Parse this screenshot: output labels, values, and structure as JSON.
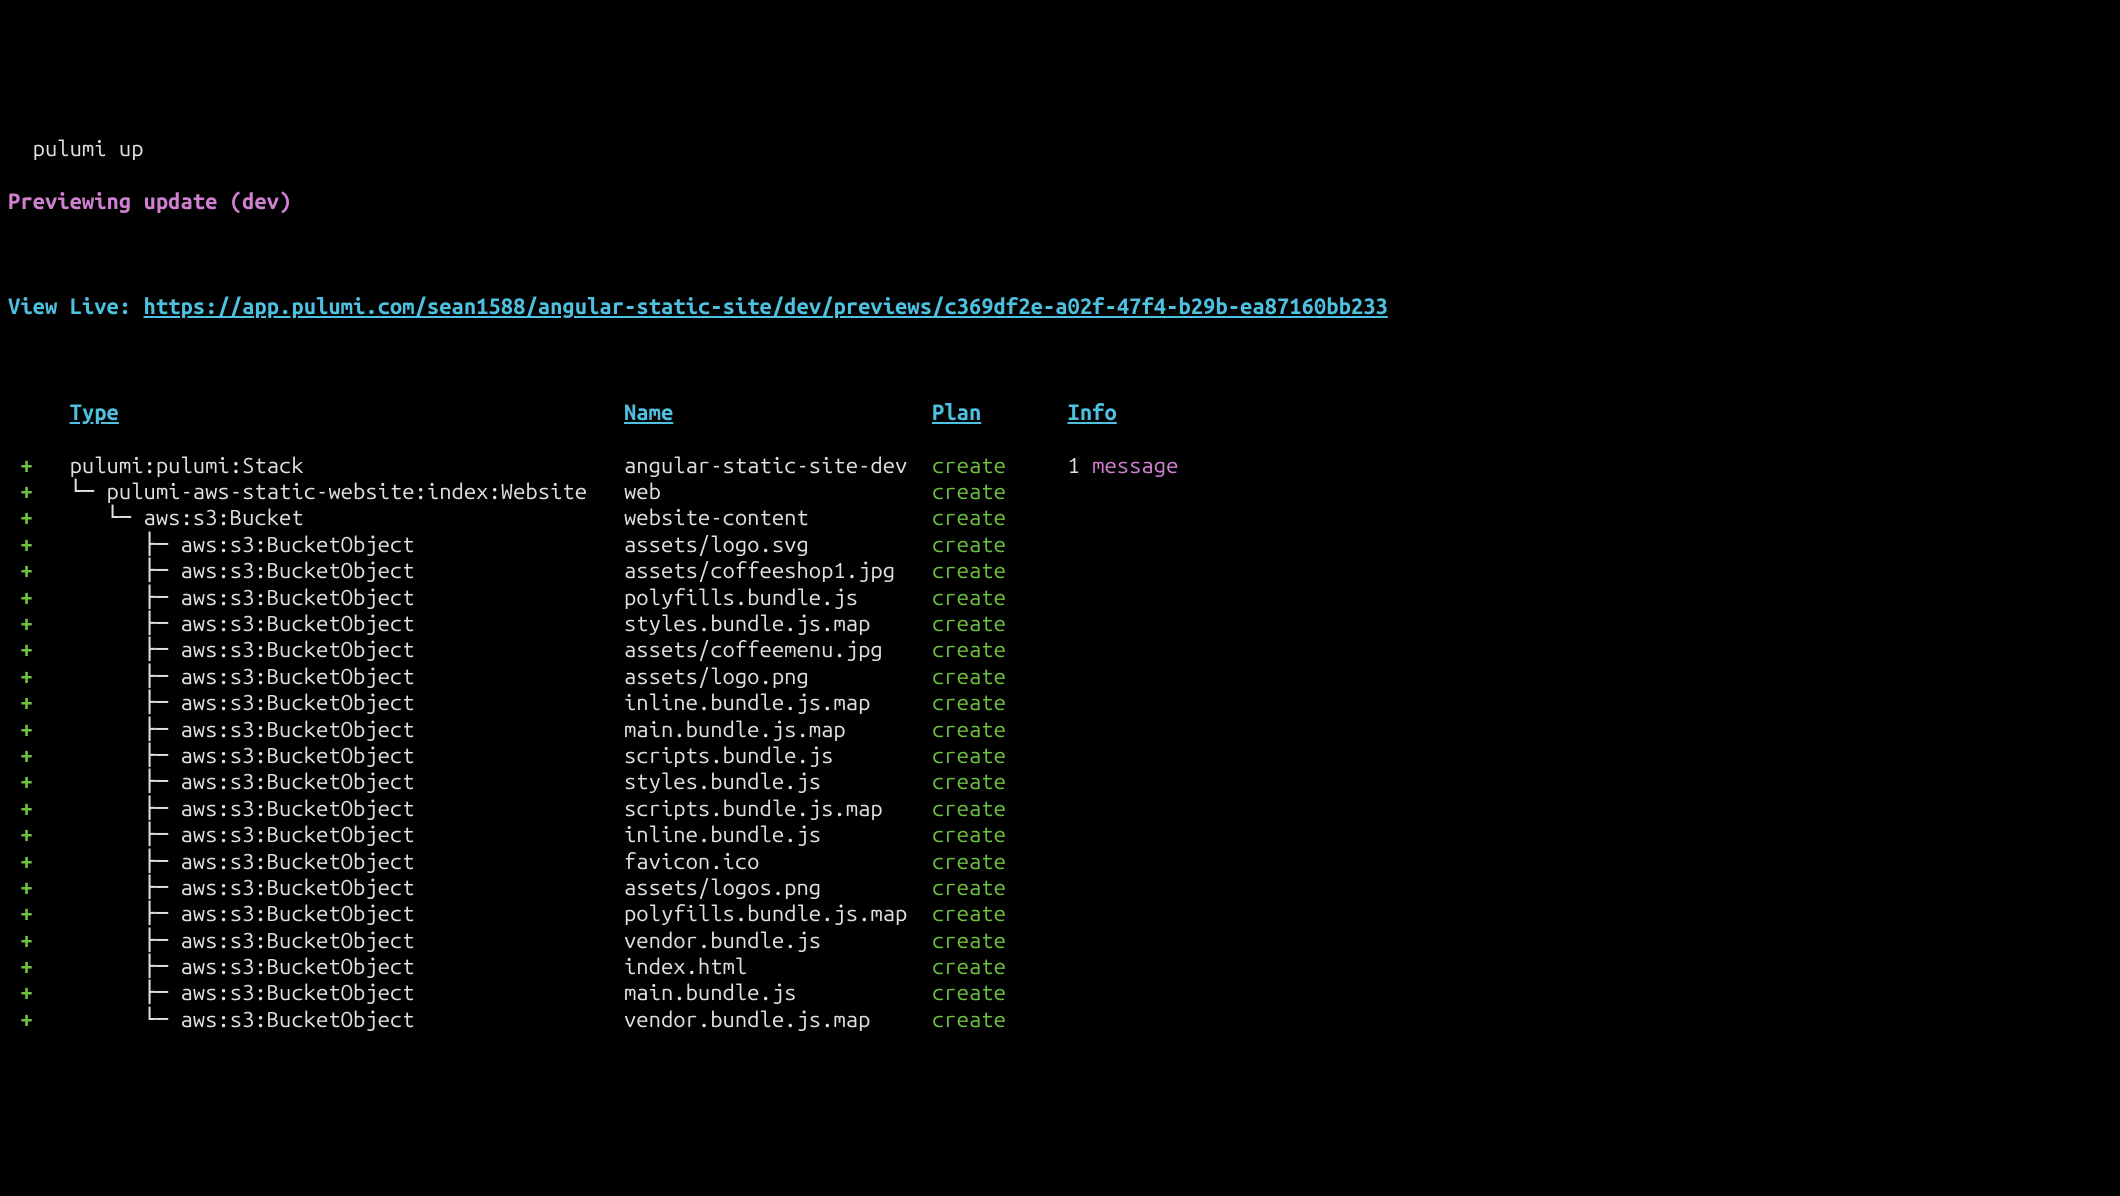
{
  "command": "pulumi up",
  "previewing_label": "Previewing update (dev)",
  "view_live_label": "View Live: ",
  "view_live_url": "https://app.pulumi.com/sean1588/angular-static-site/dev/previews/c369df2e-a02f-47f4-b29b-ea87160bb233",
  "headers": {
    "type": "Type",
    "name": "Name",
    "plan": "Plan",
    "info": "Info"
  },
  "rows": [
    {
      "sign": " + ",
      "type": "pulumi:pulumi:Stack",
      "tree_prefix": "",
      "name": "angular-static-site-dev",
      "plan": "create",
      "info_num": "1",
      "info_msg": " message"
    },
    {
      "sign": " + ",
      "type": "pulumi-aws-static-website:index:Website",
      "tree_prefix": "└─ ",
      "name": "web",
      "plan": "create",
      "info_num": "",
      "info_msg": ""
    },
    {
      "sign": " + ",
      "type": "aws:s3:Bucket",
      "tree_prefix": "   └─ ",
      "name": "website-content",
      "plan": "create",
      "info_num": "",
      "info_msg": ""
    },
    {
      "sign": " + ",
      "type": "aws:s3:BucketObject",
      "tree_prefix": "      ├─ ",
      "name": "assets/logo.svg",
      "plan": "create",
      "info_num": "",
      "info_msg": ""
    },
    {
      "sign": " + ",
      "type": "aws:s3:BucketObject",
      "tree_prefix": "      ├─ ",
      "name": "assets/coffeeshop1.jpg",
      "plan": "create",
      "info_num": "",
      "info_msg": ""
    },
    {
      "sign": " + ",
      "type": "aws:s3:BucketObject",
      "tree_prefix": "      ├─ ",
      "name": "polyfills.bundle.js",
      "plan": "create",
      "info_num": "",
      "info_msg": ""
    },
    {
      "sign": " + ",
      "type": "aws:s3:BucketObject",
      "tree_prefix": "      ├─ ",
      "name": "styles.bundle.js.map",
      "plan": "create",
      "info_num": "",
      "info_msg": ""
    },
    {
      "sign": " + ",
      "type": "aws:s3:BucketObject",
      "tree_prefix": "      ├─ ",
      "name": "assets/coffeemenu.jpg",
      "plan": "create",
      "info_num": "",
      "info_msg": ""
    },
    {
      "sign": " + ",
      "type": "aws:s3:BucketObject",
      "tree_prefix": "      ├─ ",
      "name": "assets/logo.png",
      "plan": "create",
      "info_num": "",
      "info_msg": ""
    },
    {
      "sign": " + ",
      "type": "aws:s3:BucketObject",
      "tree_prefix": "      ├─ ",
      "name": "inline.bundle.js.map",
      "plan": "create",
      "info_num": "",
      "info_msg": ""
    },
    {
      "sign": " + ",
      "type": "aws:s3:BucketObject",
      "tree_prefix": "      ├─ ",
      "name": "main.bundle.js.map",
      "plan": "create",
      "info_num": "",
      "info_msg": ""
    },
    {
      "sign": " + ",
      "type": "aws:s3:BucketObject",
      "tree_prefix": "      ├─ ",
      "name": "scripts.bundle.js",
      "plan": "create",
      "info_num": "",
      "info_msg": ""
    },
    {
      "sign": " + ",
      "type": "aws:s3:BucketObject",
      "tree_prefix": "      ├─ ",
      "name": "styles.bundle.js",
      "plan": "create",
      "info_num": "",
      "info_msg": ""
    },
    {
      "sign": " + ",
      "type": "aws:s3:BucketObject",
      "tree_prefix": "      ├─ ",
      "name": "scripts.bundle.js.map",
      "plan": "create",
      "info_num": "",
      "info_msg": ""
    },
    {
      "sign": " + ",
      "type": "aws:s3:BucketObject",
      "tree_prefix": "      ├─ ",
      "name": "inline.bundle.js",
      "plan": "create",
      "info_num": "",
      "info_msg": ""
    },
    {
      "sign": " + ",
      "type": "aws:s3:BucketObject",
      "tree_prefix": "      ├─ ",
      "name": "favicon.ico",
      "plan": "create",
      "info_num": "",
      "info_msg": ""
    },
    {
      "sign": " + ",
      "type": "aws:s3:BucketObject",
      "tree_prefix": "      ├─ ",
      "name": "assets/logos.png",
      "plan": "create",
      "info_num": "",
      "info_msg": ""
    },
    {
      "sign": " + ",
      "type": "aws:s3:BucketObject",
      "tree_prefix": "      ├─ ",
      "name": "polyfills.bundle.js.map",
      "plan": "create",
      "info_num": "",
      "info_msg": ""
    },
    {
      "sign": " + ",
      "type": "aws:s3:BucketObject",
      "tree_prefix": "      ├─ ",
      "name": "vendor.bundle.js",
      "plan": "create",
      "info_num": "",
      "info_msg": ""
    },
    {
      "sign": " + ",
      "type": "aws:s3:BucketObject",
      "tree_prefix": "      ├─ ",
      "name": "index.html",
      "plan": "create",
      "info_num": "",
      "info_msg": ""
    },
    {
      "sign": " + ",
      "type": "aws:s3:BucketObject",
      "tree_prefix": "      ├─ ",
      "name": "main.bundle.js",
      "plan": "create",
      "info_num": "",
      "info_msg": ""
    },
    {
      "sign": " + ",
      "type": "aws:s3:BucketObject",
      "tree_prefix": "      └─ ",
      "name": "vendor.bundle.js.map",
      "plan": "create",
      "info_num": "",
      "info_msg": ""
    }
  ]
}
